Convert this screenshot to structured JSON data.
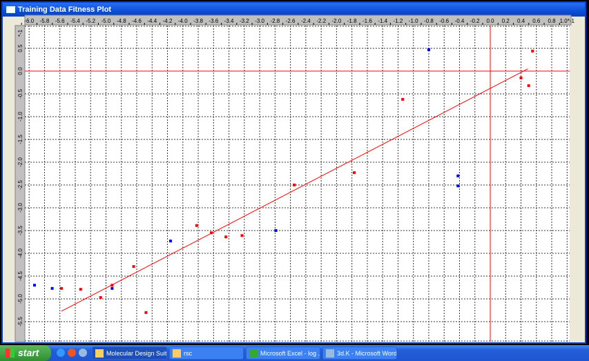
{
  "window": {
    "title": "Training Data Fitness Plot"
  },
  "chart_data": {
    "type": "scatter",
    "title": "Training Data Fitness Plot",
    "x_ticks": [
      "-6.0",
      "-5.8",
      "-5.6",
      "-5.4",
      "-5.2",
      "-5.0",
      "-4.8",
      "-4.6",
      "-4.4",
      "-4.2",
      "-4.0",
      "-3.8",
      "-3.6",
      "-3.4",
      "-3.2",
      "-3.0",
      "-2.8",
      "-2.6",
      "-2.4",
      "-2.2",
      "-2.0",
      "-1.8",
      "-1.6",
      "-1.4",
      "-1.2",
      "-1.0",
      "-0.8",
      "-0.6",
      "-0.4",
      "-0.2",
      "0.0",
      "0.2",
      "0.4",
      "0.6",
      "0.8",
      "1.0*-1"
    ],
    "y_ticks": [
      "*-1",
      "0.5",
      "0.0",
      "-0.5",
      "-1.0",
      "-1.5",
      "-2.0",
      "-2.5",
      "-3.0",
      "-3.5",
      "-4.0",
      "-4.5",
      "-5.0",
      "-5.5"
    ],
    "xlim": [
      -6.1,
      1.05
    ],
    "ylim": [
      -5.95,
      1.0
    ],
    "grid": true,
    "series": [
      {
        "name": "blue points",
        "color": "#0000ff",
        "points": [
          [
            -5.93,
            -4.7
          ],
          [
            -5.7,
            -4.77
          ],
          [
            -4.92,
            -4.77
          ],
          [
            -4.16,
            -3.73
          ],
          [
            -2.79,
            -3.5
          ],
          [
            -0.8,
            0.47
          ],
          [
            -0.42,
            -2.3
          ],
          [
            -0.42,
            -2.52
          ]
        ]
      },
      {
        "name": "red points",
        "color": "#ff0000",
        "points": [
          [
            -5.58,
            -4.77
          ],
          [
            -5.33,
            -4.79
          ],
          [
            -5.07,
            -4.97
          ],
          [
            -4.92,
            -4.7
          ],
          [
            -4.64,
            -4.29
          ],
          [
            -4.48,
            -5.3
          ],
          [
            -3.82,
            -3.39
          ],
          [
            -3.63,
            -3.55
          ],
          [
            -3.44,
            -3.64
          ],
          [
            -3.23,
            -3.61
          ],
          [
            -2.55,
            -2.5
          ],
          [
            -1.77,
            -2.23
          ],
          [
            -1.14,
            -0.62
          ],
          [
            0.4,
            -0.15
          ],
          [
            0.5,
            -0.32
          ],
          [
            0.55,
            0.44
          ]
        ]
      }
    ],
    "fit_line": {
      "color": "#ff0000",
      "from": [
        -5.58,
        -5.27
      ],
      "to": [
        0.49,
        0.05
      ]
    },
    "reference_lines": {
      "x": 0.0,
      "y": 0.0,
      "color": "#ff0000"
    }
  },
  "taskbar": {
    "start": "start",
    "items": [
      {
        "label": "Molecular Design Suite",
        "active": true
      },
      {
        "label": "rsc"
      },
      {
        "label": "Microsoft Excel - log ..."
      },
      {
        "label": "3d.K - Microsoft Word"
      }
    ]
  }
}
